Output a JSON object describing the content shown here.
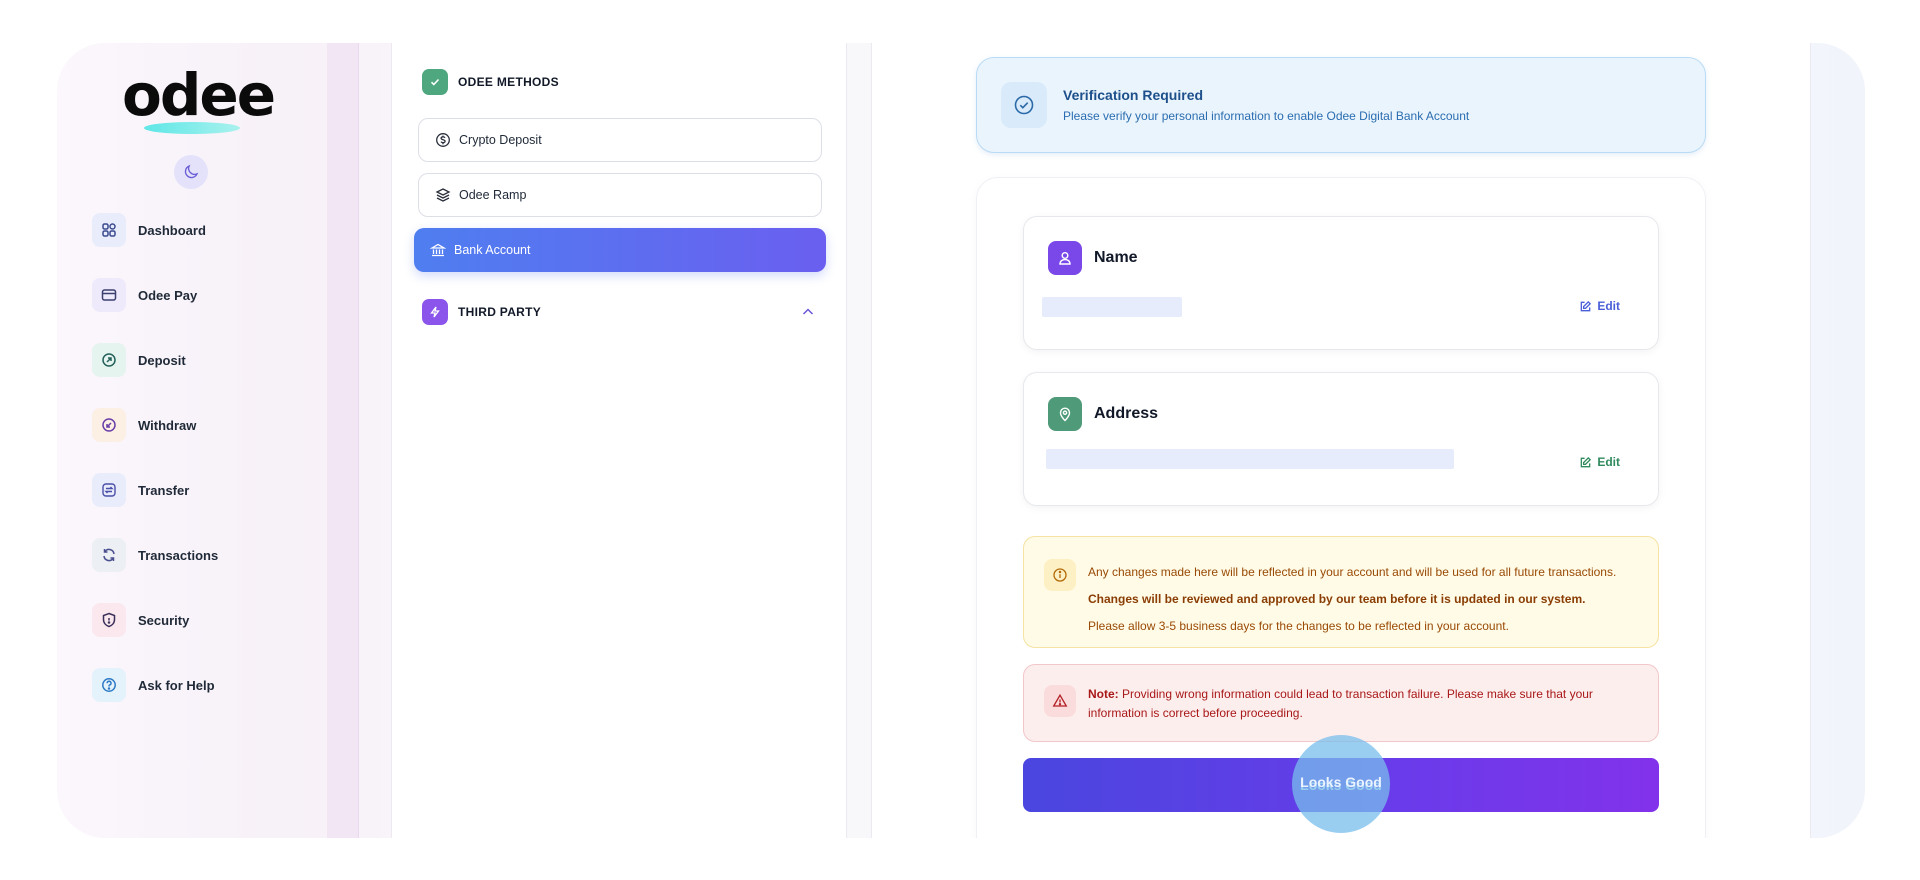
{
  "brand": {
    "logo_text": "odee"
  },
  "sidebar": {
    "items": [
      {
        "label": "Dashboard",
        "icon": "grid-icon"
      },
      {
        "label": "Odee Pay",
        "icon": "card-icon"
      },
      {
        "label": "Deposit",
        "icon": "arrow-up-circle-icon"
      },
      {
        "label": "Withdraw",
        "icon": "arrow-down-circle-icon"
      },
      {
        "label": "Transfer",
        "icon": "transfer-icon"
      },
      {
        "label": "Transactions",
        "icon": "refresh-icon"
      },
      {
        "label": "Security",
        "icon": "shield-icon"
      },
      {
        "label": "Ask for Help",
        "icon": "help-icon"
      }
    ]
  },
  "methods": {
    "odee_title": "ODEE METHODS",
    "items": [
      {
        "label": "Crypto Deposit",
        "icon": "dollar-circle-icon"
      },
      {
        "label": "Odee Ramp",
        "icon": "layers-icon"
      },
      {
        "label": "Bank Account",
        "icon": "bank-icon",
        "active": true
      }
    ],
    "third_party_title": "THIRD PARTY"
  },
  "verification": {
    "title": "Verification Required",
    "text": "Please verify your personal information to enable Odee Digital Bank Account"
  },
  "name_card": {
    "title": "Name",
    "edit_label": "Edit"
  },
  "address_card": {
    "title": "Address",
    "edit_label": "Edit"
  },
  "notice": {
    "line1": "Any changes made here will be reflected in your account and will be used for all future transactions.",
    "line2": "Changes will be reviewed and approved by our team before it is updated in our system.",
    "line3": "Please allow 3-5 business days for the changes to be reflected in your account."
  },
  "warning": {
    "label": "Note:",
    "text": " Providing wrong information could lead to transaction failure. Please make sure that your information is correct before proceeding."
  },
  "submit": {
    "label": "Looks Good"
  },
  "colors": {
    "accent": "#5b6cf0",
    "primary_button": "#5a3fe6",
    "name_icon": "#7c4dea",
    "address_icon": "#4f9a78"
  }
}
